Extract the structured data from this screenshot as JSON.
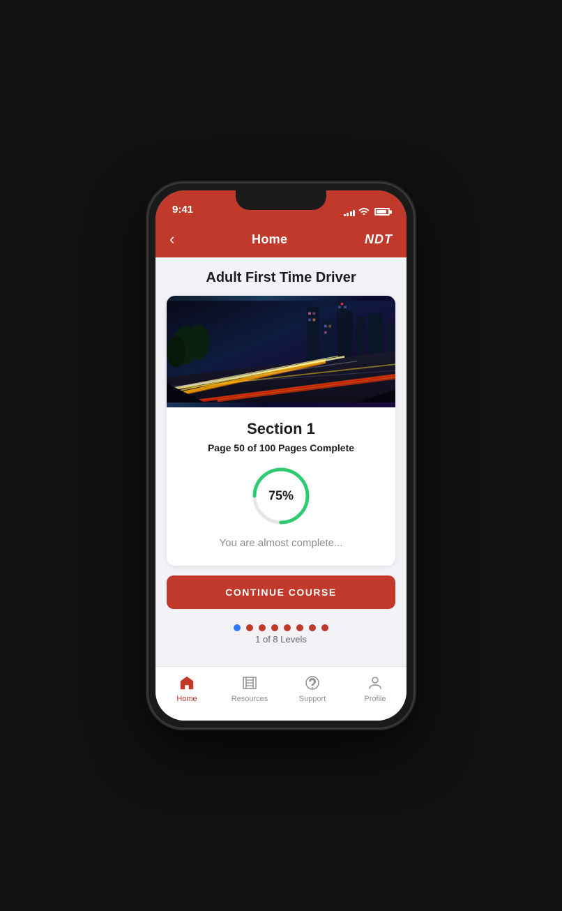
{
  "phone": {
    "status": {
      "time": "9:41",
      "signal": [
        3,
        5,
        7,
        9,
        11
      ],
      "wifi": "wifi",
      "battery": 80
    },
    "nav": {
      "back_label": "‹",
      "title": "Home",
      "brand": "NDT"
    },
    "content": {
      "page_title": "Adult First Time Driver",
      "section_title": "Section 1",
      "pages_complete": "Page 50 of 100 Pages Complete",
      "progress_percent": 75,
      "progress_label": "75%",
      "progress_radius": 38,
      "progress_circumference": 238.76,
      "progress_dash": 179.07,
      "almost_complete": "You are almost complete...",
      "continue_button": "CONTINUE COURSE",
      "levels_label": "1 of 8 Levels",
      "dots": [
        {
          "active": true
        },
        {
          "active": false
        },
        {
          "active": false
        },
        {
          "active": false
        },
        {
          "active": false
        },
        {
          "active": false
        },
        {
          "active": false
        },
        {
          "active": false
        }
      ]
    },
    "tabs": [
      {
        "label": "Home",
        "icon": "home-icon",
        "active": true
      },
      {
        "label": "Resources",
        "icon": "resources-icon",
        "active": false
      },
      {
        "label": "Support",
        "icon": "support-icon",
        "active": false
      },
      {
        "label": "Profile",
        "icon": "profile-icon",
        "active": false
      }
    ]
  }
}
